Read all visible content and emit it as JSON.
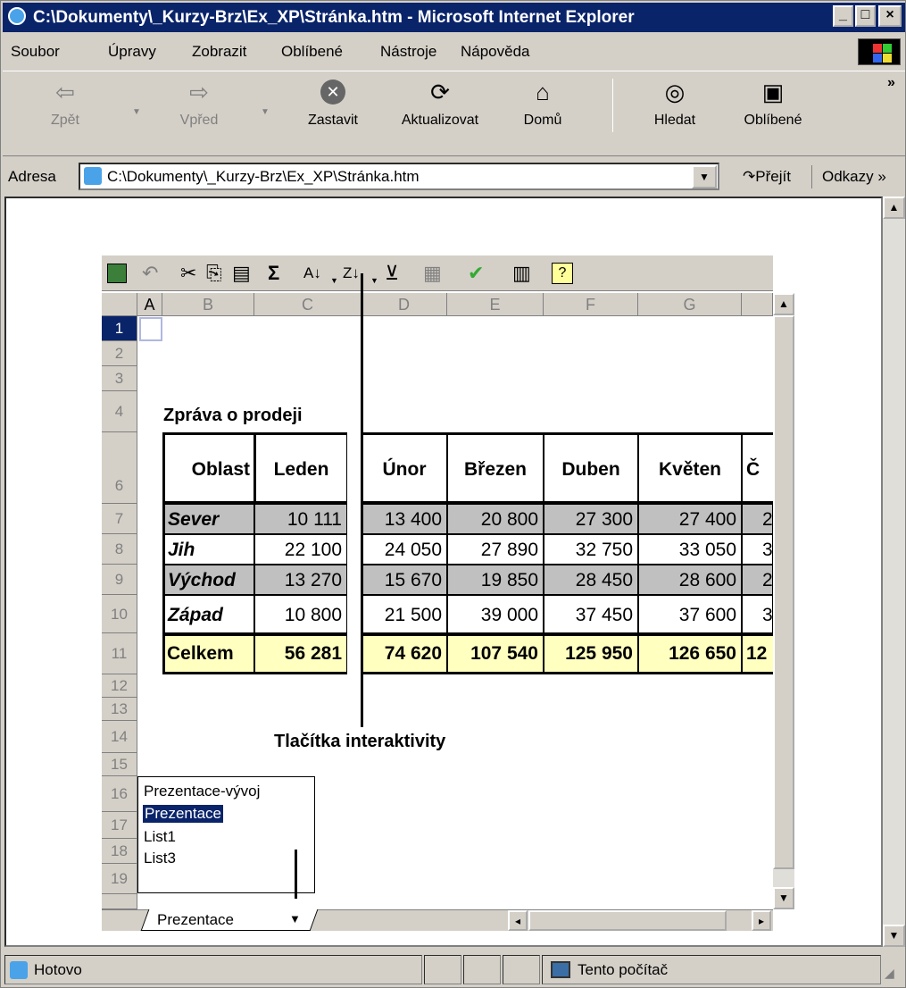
{
  "window": {
    "title": "C:\\Dokumenty\\_Kurzy-Brz\\Ex_XP\\Stránka.htm - Microsoft Internet Explorer"
  },
  "menu": [
    "Soubor",
    "Úpravy",
    "Zobrazit",
    "Oblíbené",
    "Nástroje",
    "Nápověda"
  ],
  "toolbar": {
    "back": "Zpět",
    "forward": "Vpřed",
    "stop": "Zastavit",
    "refresh": "Aktualizovat",
    "home": "Domů",
    "search": "Hledat",
    "favorites": "Oblíbené",
    "more": "»"
  },
  "address": {
    "label": "Adresa",
    "value": "C:\\Dokumenty\\_Kurzy-Brz\\Ex_XP\\Stránka.htm",
    "go": "Přejít",
    "links": "Odkazy »"
  },
  "sheet": {
    "columns": [
      "A",
      "B",
      "C",
      "D",
      "E",
      "F",
      "G"
    ],
    "rows": [
      "1",
      "2",
      "3",
      "4",
      "6",
      "7",
      "8",
      "9",
      "10",
      "11",
      "12",
      "13",
      "14",
      "15",
      "16",
      "17",
      "18",
      "19"
    ],
    "title": "Zpráva o prodeji",
    "headers": [
      "Oblast",
      "Leden",
      "Únor",
      "Březen",
      "Duben",
      "Květen",
      "Č"
    ],
    "data": [
      [
        "Sever",
        "10 111",
        "13 400",
        "20 800",
        "27 300",
        "27 400",
        "2"
      ],
      [
        "Jih",
        "22 100",
        "24 050",
        "27 890",
        "32 750",
        "33 050",
        "3"
      ],
      [
        "Východ",
        "13 270",
        "15 670",
        "19 850",
        "28 450",
        "28 600",
        "2"
      ],
      [
        "Západ",
        "10 800",
        "21 500",
        "39 000",
        "37 450",
        "37 600",
        "3"
      ]
    ],
    "total": [
      "Celkem",
      "56 281",
      "74 620",
      "107 540",
      "125 950",
      "126 650",
      "12"
    ],
    "annotation": "Tlačítka interaktivity",
    "sheet_list": [
      "Prezentace-vývoj",
      "Prezentace",
      "List1",
      "List3"
    ],
    "active_tab": "Prezentace"
  },
  "status": {
    "text": "Hotovo",
    "zone": "Tento počítač"
  }
}
